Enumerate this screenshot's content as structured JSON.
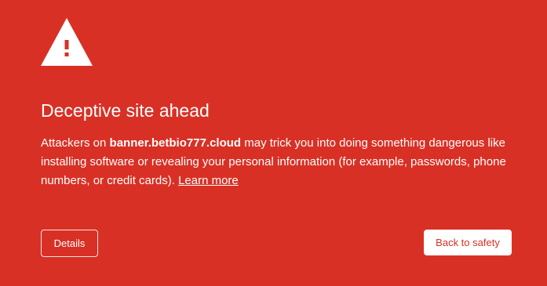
{
  "page": {
    "background_color": "#d93025",
    "accent_text_color": "#ffffff"
  },
  "icon": "warning-triangle-icon",
  "title": "Deceptive site ahead",
  "message": {
    "prefix": "Attackers on ",
    "domain": "banner.betbio777.cloud",
    "suffix": " may trick you into doing something dangerous like installing software or revealing your personal information (for example, passwords, phone numbers, or credit cards). ",
    "learn_more": "Learn more"
  },
  "buttons": {
    "details": "Details",
    "back_to_safety": "Back to safety"
  }
}
